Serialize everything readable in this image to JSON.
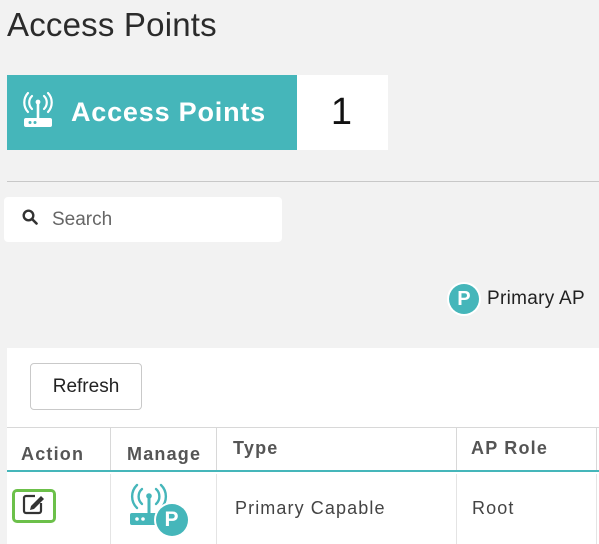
{
  "page": {
    "title": "Access Points"
  },
  "summary_card": {
    "label": "Access Points",
    "count": "1",
    "accent": "#45b6ba",
    "icon": "access-point-icon"
  },
  "search": {
    "placeholder": "Search",
    "value": "",
    "icon": "search-icon"
  },
  "legend": {
    "badge": "P",
    "label": "Primary AP"
  },
  "toolbar": {
    "refresh_label": "Refresh"
  },
  "table": {
    "columns": [
      "Action",
      "Manage",
      "Type",
      "AP Role"
    ],
    "rows": [
      {
        "action_icon": "edit-icon",
        "manage_icon": "access-point-icon",
        "manage_badge": "P",
        "type": "Primary Capable",
        "role": "Root"
      }
    ]
  },
  "colors": {
    "accent": "#45b6ba",
    "edit_highlight": "#6cc04a"
  }
}
